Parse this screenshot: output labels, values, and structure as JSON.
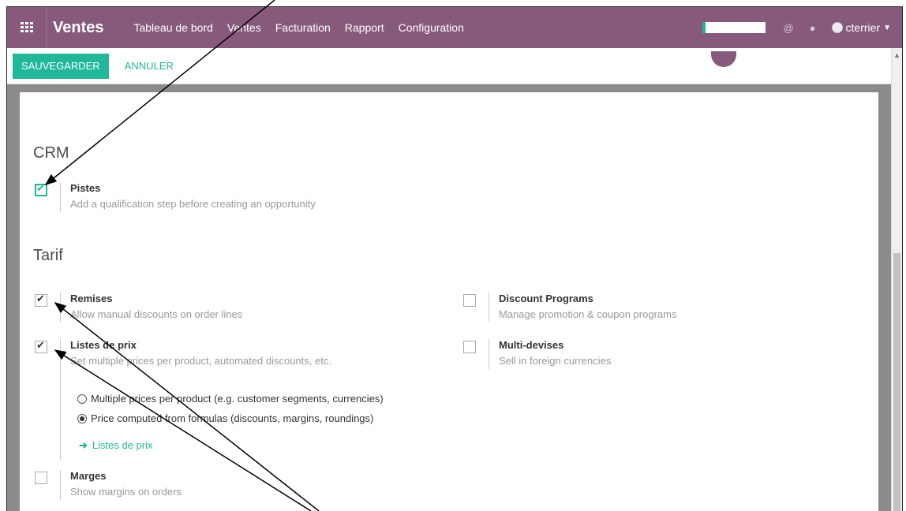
{
  "topbar": {
    "app_name": "Ventes",
    "menu": [
      "Tableau de bord",
      "Ventes",
      "Facturation",
      "Rapport",
      "Configuration"
    ],
    "progress_fraction": 0.05,
    "user": "cterrier",
    "accent": "#875a7b"
  },
  "control": {
    "save_label": "SAUVEGARDER",
    "cancel_label": "ANNULER",
    "save_color": "#21b799"
  },
  "sections": {
    "crm": {
      "title": "CRM",
      "pistes_label": "Pistes",
      "pistes_desc": "Add a qualification step before creating an opportunity"
    },
    "tarif": {
      "title": "Tarif",
      "remises_label": "Remises",
      "remises_desc": "Allow manual discounts on order lines",
      "listes_label": "Listes de prix",
      "listes_desc": "Set multiple prices per product, automated discounts, etc.",
      "radio1": "Multiple prices per product (e.g. customer segments, currencies)",
      "radio2": "Price computed from formulas (discounts, margins, roundings)",
      "link": "Listes de prix",
      "marges_label": "Marges",
      "marges_desc": "Show margins on orders",
      "discount_label": "Discount Programs",
      "discount_desc": "Manage promotion & coupon programs",
      "multidev_label": "Multi-devises",
      "multidev_desc": "Sell in foreign currencies"
    }
  }
}
